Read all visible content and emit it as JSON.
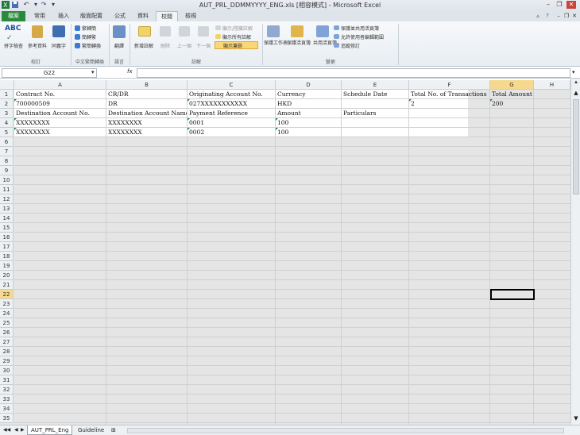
{
  "window": {
    "title": "AUT_PRL_DDMMYYYY_ENG.xls [相容模式] - Microsoft Excel"
  },
  "ribbon_tabs": [
    {
      "label": "檔案"
    },
    {
      "label": "常用"
    },
    {
      "label": "插入"
    },
    {
      "label": "版面配置"
    },
    {
      "label": "公式"
    },
    {
      "label": "資料"
    },
    {
      "label": "校閱"
    },
    {
      "label": "檢視"
    }
  ],
  "ribbon": {
    "spelling": "拼字檢查",
    "research": "參考資料",
    "thesaurus": "同義字",
    "to_traditional": "繁轉簡",
    "to_simplified": "簡轉繁",
    "convert": "繁簡轉換",
    "translate": "翻譯",
    "new_comment": "新增註解",
    "delete": "刪除",
    "prev": "上一個",
    "next": "下一個",
    "show_hide_comment": "顯示/隱藏註解",
    "show_all_comments": "顯示所有註解",
    "show_ink": "顯示筆跡",
    "protect_sheet": "保護工作表",
    "protect_workbook": "保護活頁簿",
    "share_workbook": "共用活頁簿",
    "protect_share": "保護並共用活頁簿",
    "allow_edit": "允許使用者編輯範圍",
    "track_changes": "追蹤修訂",
    "groups": {
      "proofing": "校訂",
      "chinese": "中文繁簡轉換",
      "language": "語言",
      "comments": "註解",
      "changes": "變更"
    }
  },
  "formula_bar": {
    "name_box": "G22",
    "fx": "fx",
    "value": ""
  },
  "columns": [
    "A",
    "B",
    "C",
    "D",
    "E",
    "F",
    "G",
    "H"
  ],
  "rows": [
    "1",
    "2",
    "3",
    "4",
    "5",
    "6",
    "7",
    "8",
    "9",
    "10",
    "11",
    "12",
    "13",
    "14",
    "15",
    "16",
    "17",
    "18",
    "19",
    "20",
    "21",
    "22",
    "23",
    "24",
    "25",
    "26",
    "27",
    "28",
    "29",
    "30",
    "31",
    "32",
    "33",
    "34",
    "35"
  ],
  "cells": {
    "r1": [
      "Contract No.",
      "CR/DR",
      "Originating Account No.",
      "Currency",
      "Schedule Date",
      "Total No. of Transactions",
      "Total Amount"
    ],
    "r2": [
      "700000509",
      "DR",
      "027XXXXXXXXXXX",
      "HKD",
      "",
      "2",
      "200"
    ],
    "r3": [
      "Destination Account No.",
      "Destination Account Name",
      "Payment Reference",
      "Amount",
      "Particulars",
      "",
      ""
    ],
    "r4": [
      "XXXXXXXX",
      "XXXXXXXX",
      "0001",
      "100",
      "",
      "",
      ""
    ],
    "r5": [
      "XXXXXXXX",
      "XXXXXXXX",
      "0002",
      "100",
      "",
      "",
      ""
    ]
  },
  "sheets": [
    {
      "label": "AUT_PRL_Eng"
    },
    {
      "label": "Guideline"
    }
  ],
  "selected_cell": "G22"
}
